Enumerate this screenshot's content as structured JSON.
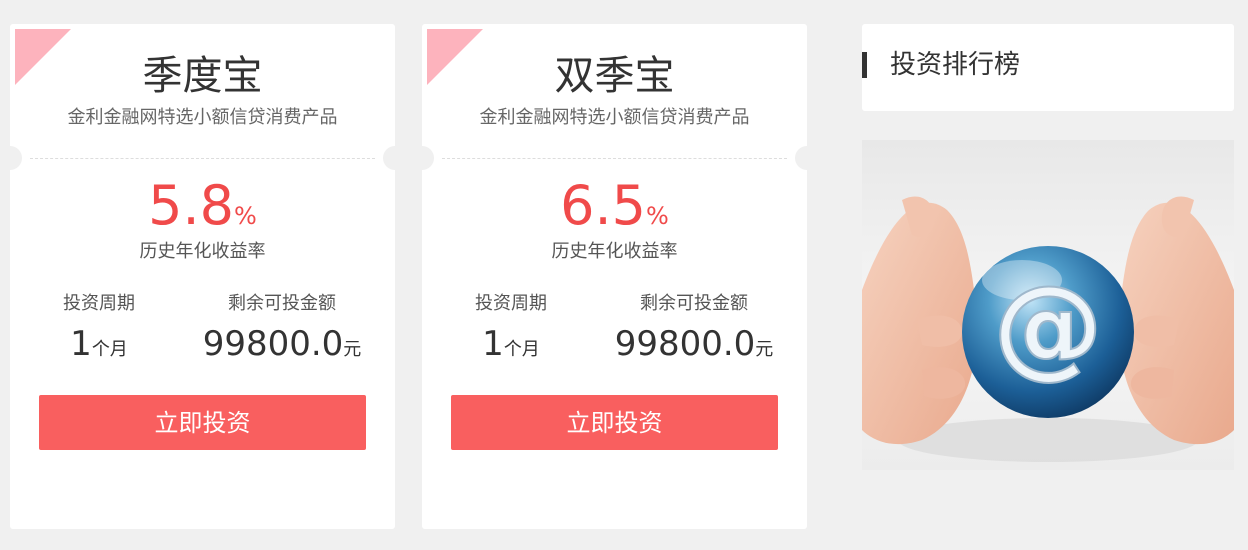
{
  "products": [
    {
      "name": "季度宝",
      "subtitle": "金利金融网特选小额信贷消费产品",
      "rate": "5.8",
      "rate_unit": "%",
      "rate_label": "历史年化收益率",
      "period_label": "投资周期",
      "period_value": "1",
      "period_unit": "个月",
      "remaining_label": "剩余可投金额",
      "remaining_value": "99800.0",
      "remaining_unit": "元",
      "button_label": "立即投资"
    },
    {
      "name": "双季宝",
      "subtitle": "金利金融网特选小额信贷消费产品",
      "rate": "6.5",
      "rate_unit": "%",
      "rate_label": "历史年化收益率",
      "period_label": "投资周期",
      "period_value": "1",
      "period_unit": "个月",
      "remaining_label": "剩余可投金额",
      "remaining_value": "99800.0",
      "remaining_unit": "元",
      "button_label": "立即投资"
    }
  ],
  "ranking": {
    "title": "投资排行榜"
  },
  "banner": {
    "text": "@"
  },
  "colors": {
    "accent": "#f95f5f",
    "rate": "#f04a4a",
    "corner": "#fdb3bd",
    "background": "#f0f0f0"
  }
}
